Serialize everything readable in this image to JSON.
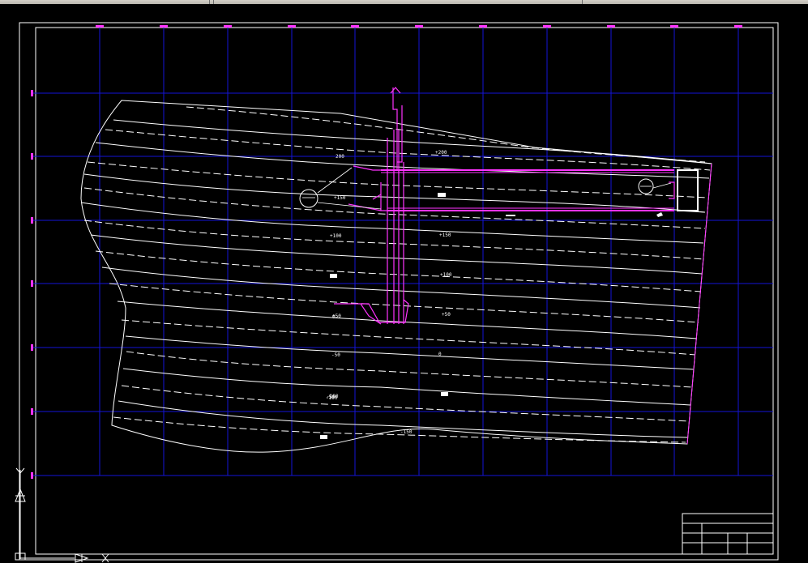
{
  "window": {
    "title": ""
  },
  "drawing": {
    "background": "#000000",
    "grid_color": "#1414d8",
    "contour_color": "#ffffff",
    "alignment_color": "#ff33ff",
    "border_color": "#ffffff",
    "contour_labels": [
      {
        "text": "+150"
      },
      {
        "text": "+100"
      },
      {
        "text": "+50"
      },
      {
        "text": "0"
      },
      {
        "text": "-50"
      },
      {
        "text": "-100"
      },
      {
        "text": "-150"
      },
      {
        "text": "+200"
      },
      {
        "text": "+150"
      },
      {
        "text": "+100"
      },
      {
        "text": "+50"
      },
      {
        "text": "0"
      },
      {
        "text": "-50"
      },
      {
        "text": "-100"
      },
      {
        "text": "200"
      }
    ],
    "callouts": [
      {
        "text": ""
      },
      {
        "text": ""
      }
    ]
  },
  "ucs_icon": {
    "y_label": "Y",
    "x_label": "X"
  },
  "title_block": {
    "rows": 4,
    "cols": 5
  }
}
